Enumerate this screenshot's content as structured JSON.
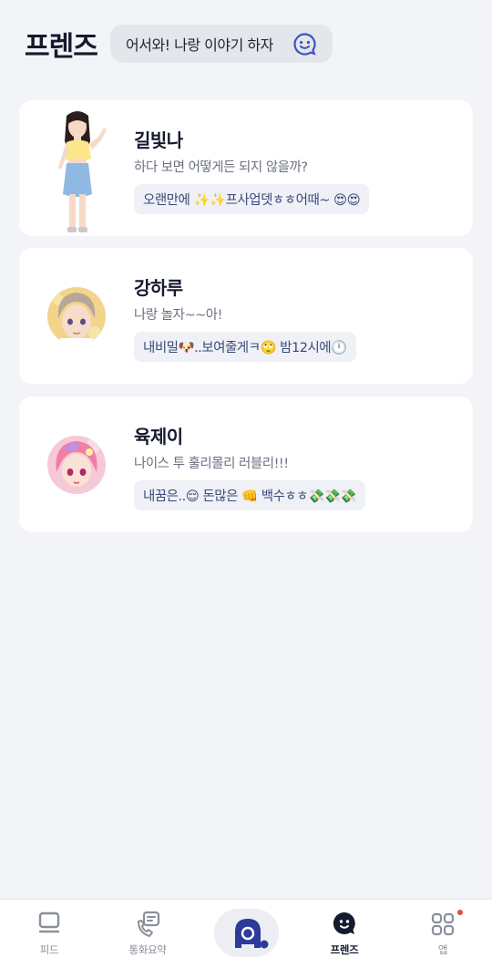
{
  "header": {
    "title": "프렌즈",
    "greeting": "어서와! 나랑 이야기 하자",
    "greeting_icon": "smile-chat-icon"
  },
  "friends": [
    {
      "name": "길빛나",
      "status": "하다 보면 어떻게든 되지 않을까?",
      "last_message": "오랜만에 ✨✨프사업뎃ㅎㅎ어때~ 😍😍",
      "avatar": "girl-fullbody-avatar"
    },
    {
      "name": "강하루",
      "status": "나랑 놀자~~아!",
      "last_message": "내비밀🐶..보여줄게ㅋ🙄 밤12시에🕛",
      "avatar": "boy-portrait-avatar"
    },
    {
      "name": "육제이",
      "status": "나이스 투 훌리몰리 러블리!!!",
      "last_message": "내꿈은..😌 돈많은 👊 백수ㅎㅎ💸💸💸",
      "avatar": "pink-hair-portrait-avatar"
    }
  ],
  "tabbar": {
    "tabs": [
      {
        "label": "피드",
        "icon": "feed-icon"
      },
      {
        "label": "통화요약",
        "icon": "call-summary-icon"
      },
      {
        "label": "",
        "icon": "home-logo-icon"
      },
      {
        "label": "프렌즈",
        "icon": "friends-icon"
      },
      {
        "label": "앱",
        "icon": "apps-grid-icon"
      }
    ],
    "active": "프렌즈"
  },
  "colors": {
    "background": "#f3f4f8",
    "card": "#ffffff",
    "accent": "#2b3a8c",
    "chip_text": "#3b4a7a",
    "notification": "#e24b3b"
  }
}
